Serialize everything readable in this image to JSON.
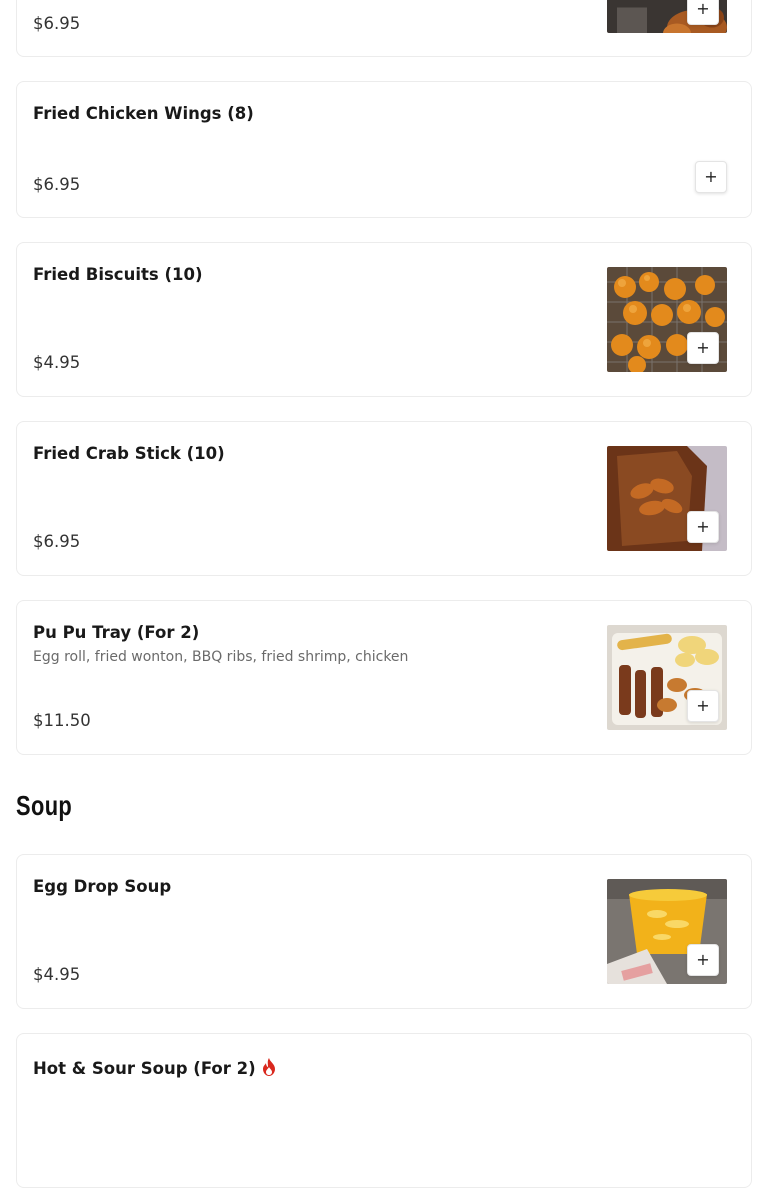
{
  "add_label": "+",
  "cards": [
    {
      "price": "$6.95"
    },
    {
      "name": "Fried Chicken Wings (8)",
      "price": "$6.95"
    },
    {
      "name": "Fried Biscuits (10)",
      "price": "$4.95"
    },
    {
      "name": "Fried Crab Stick (10)",
      "price": "$6.95"
    },
    {
      "name": "Pu Pu Tray (For 2)",
      "desc": "Egg roll, fried wonton, BBQ ribs, fried shrimp, chicken",
      "price": "$11.50"
    },
    {
      "name": "Egg Drop Soup",
      "price": "$4.95"
    },
    {
      "name": "Hot & Sour Soup (For 2)",
      "spicy_icon": "flame-icon"
    }
  ],
  "section": {
    "title": "Soup"
  }
}
